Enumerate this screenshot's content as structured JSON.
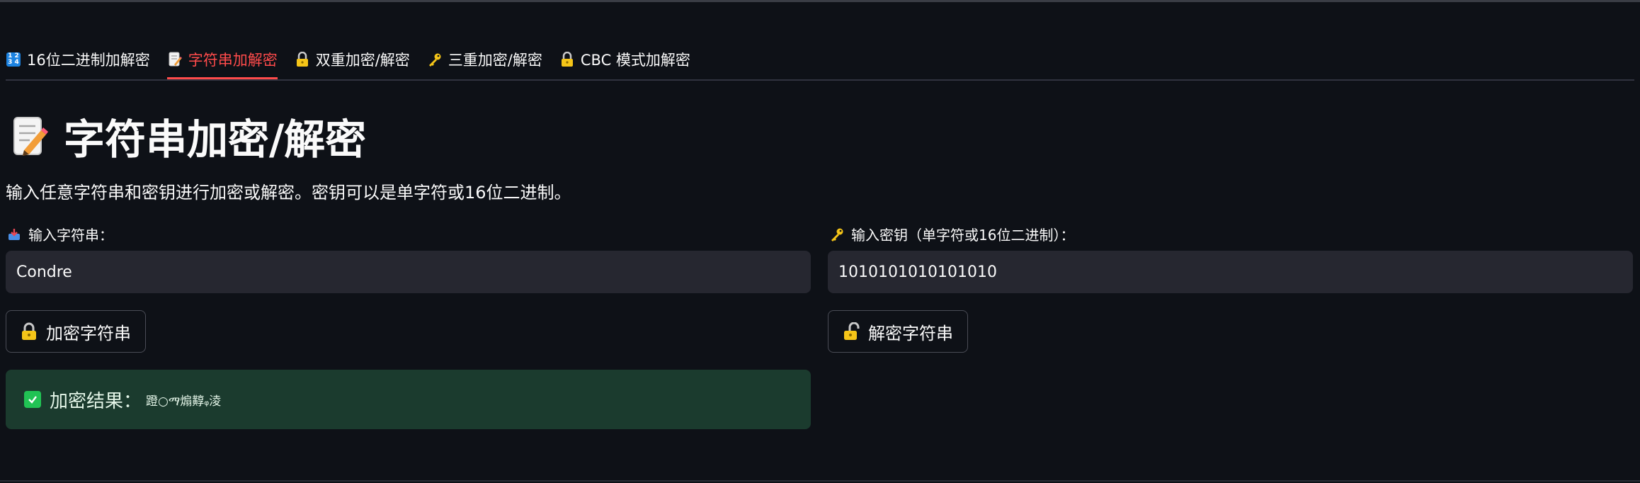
{
  "tabs": [
    {
      "label": "16位二进制加解密",
      "icon": "binary-grid-icon",
      "active": false
    },
    {
      "label": "字符串加解密",
      "icon": "memo-icon",
      "active": true
    },
    {
      "label": "双重加密/解密",
      "icon": "lock-icon",
      "active": false
    },
    {
      "label": "三重加密/解密",
      "icon": "key-icon",
      "active": false
    },
    {
      "label": "CBC 模式加解密",
      "icon": "lock-icon",
      "active": false
    }
  ],
  "page": {
    "title": "字符串加密/解密",
    "description": "输入任意字符串和密钥进行加密或解密。密钥可以是单字符或16位二进制。"
  },
  "string_input": {
    "label": "输入字符串：",
    "value": "Condre"
  },
  "key_input": {
    "label": "输入密钥（单字符或16位二进制）：",
    "value": "1010101010101010"
  },
  "buttons": {
    "encrypt_label": "加密字符串",
    "decrypt_label": "解密字符串"
  },
  "result": {
    "label": "加密结果：",
    "value": "蹬○ማ煽䵍ᵩ淩"
  },
  "colors": {
    "background": "#0e1117",
    "accent": "#ff4b4b",
    "input_bg": "#262730",
    "success_bg": "#1b3b2e",
    "success_check": "#21c354"
  }
}
